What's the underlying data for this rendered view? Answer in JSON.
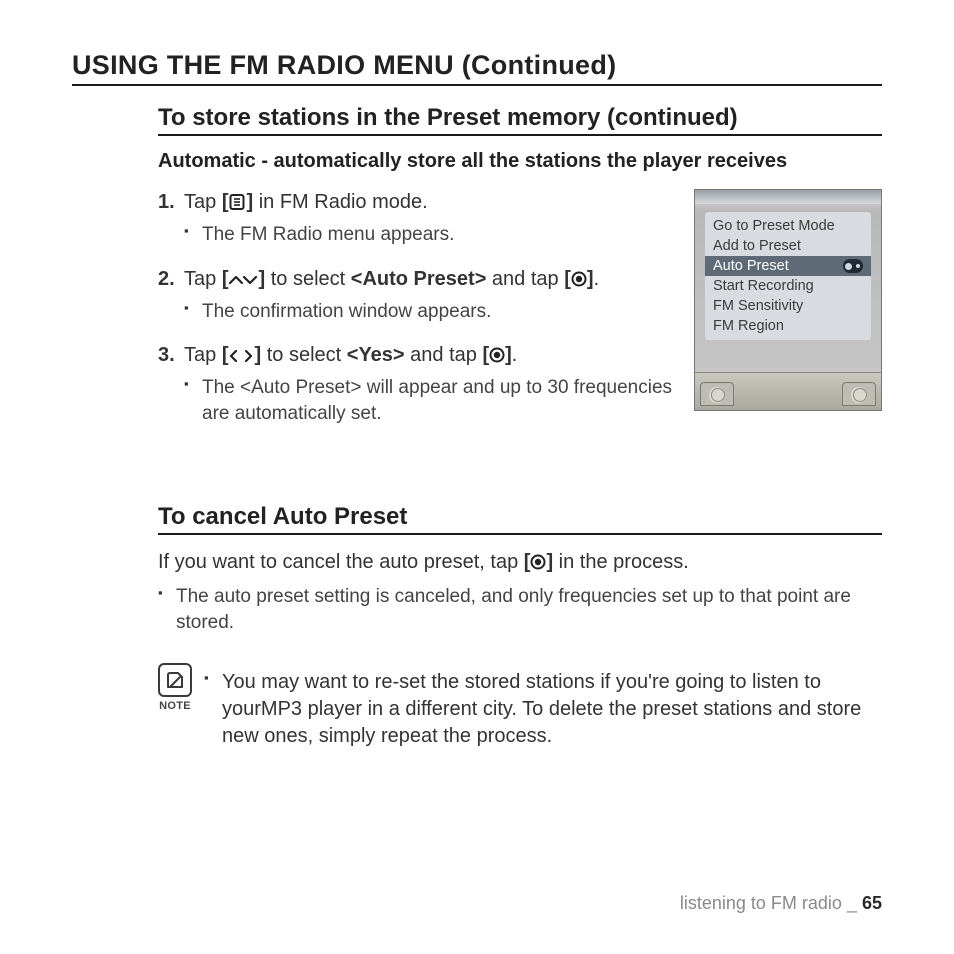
{
  "page_title": "USING THE FM RADIO MENU (Continued)",
  "section1": {
    "title": "To store stations in the Preset memory (continued)",
    "subtitle": "Automatic - automatically store all the stations the player receives",
    "steps": [
      {
        "num": "1.",
        "pre": "Tap ",
        "btn_open": "[",
        "btn_close": "]",
        "post": " in FM Radio mode.",
        "notes": [
          "The FM Radio menu appears."
        ]
      },
      {
        "num": "2.",
        "pre": "Tap ",
        "btn_open": "[",
        "btn_close": "]",
        "mid1": " to select ",
        "ref": "<Auto Preset>",
        "mid2": " and tap ",
        "btn2_open": "[",
        "btn2_close": "]",
        "post": ".",
        "notes": [
          "The confirmation window appears."
        ]
      },
      {
        "num": "3.",
        "pre": "Tap ",
        "btn_open": "[",
        "btn_close": "]",
        "mid1": " to select ",
        "ref": "<Yes>",
        "mid2": " and tap ",
        "btn2_open": "[",
        "btn2_close": "]",
        "post": ".",
        "notes": [
          "The <Auto Preset> will appear and up to 30 frequencies are automatically set."
        ]
      }
    ]
  },
  "device_menu": {
    "items": [
      {
        "label": "Go to Preset Mode",
        "selected": false
      },
      {
        "label": "Add to Preset",
        "selected": false
      },
      {
        "label": "Auto Preset",
        "selected": true
      },
      {
        "label": "Start Recording",
        "selected": false
      },
      {
        "label": "FM Sensitivity",
        "selected": false
      },
      {
        "label": "FM Region",
        "selected": false
      }
    ]
  },
  "section2": {
    "title": "To cancel Auto Preset",
    "intro_pre": "If you want to cancel the auto preset, tap ",
    "btn_open": "[",
    "btn_close": "]",
    "intro_post": " in the process.",
    "notes": [
      "The auto preset setting is canceled, and only frequencies set up to that point are stored."
    ]
  },
  "note_block": {
    "label": "NOTE",
    "items": [
      "You may want to re-set the stored stations if you're going to listen to yourMP3 player in a different city. To delete the preset stations and store new ones, simply repeat the process."
    ]
  },
  "footer": {
    "text": "listening to FM radio _ ",
    "page": "65"
  }
}
